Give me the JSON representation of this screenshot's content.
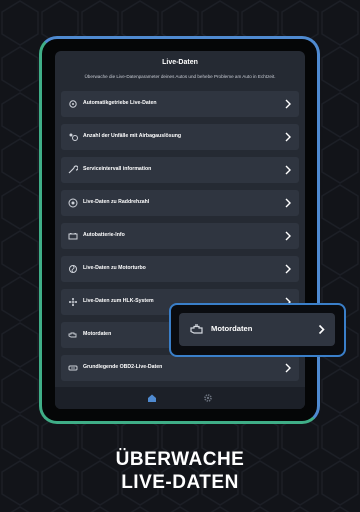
{
  "screen": {
    "title": "Live-Daten",
    "subtitle": "Überwache die Live-Datenparameter deines Autos und behebe Probleme am Auto in Echtzeit."
  },
  "items": [
    {
      "label": "Automatikgetriebe Live-Daten",
      "icon": "gearbox-icon"
    },
    {
      "label": "Anzahl der Unfälle mit Airbagauslösung",
      "icon": "airbag-icon"
    },
    {
      "label": "Serviceintervall information",
      "icon": "service-icon"
    },
    {
      "label": "Live-Daten zu Raddrehzahl",
      "icon": "wheel-icon"
    },
    {
      "label": "Autobatterie-Info",
      "icon": "battery-icon"
    },
    {
      "label": "Live-Daten zu Motorturbo",
      "icon": "turbo-icon"
    },
    {
      "label": "Live-Daten zum HLK-System",
      "icon": "fan-icon"
    },
    {
      "label": "Motordaten",
      "icon": "engine-icon"
    },
    {
      "label": "Grundlegende OBD2-Live-Daten",
      "icon": "obd-icon"
    }
  ],
  "highlight": {
    "label": "Motordaten",
    "icon": "engine-icon"
  },
  "nav": {
    "home_icon": "home-icon",
    "settings_icon": "gear-icon"
  },
  "caption": {
    "line1": "ÜBERWACHE",
    "line2": "LIVE-DATEN"
  },
  "colors": {
    "background": "#121419",
    "screen": "#252a33",
    "card": "#2f3540",
    "accent_blue": "#3a7fc9",
    "accent_green": "#3fae87"
  }
}
